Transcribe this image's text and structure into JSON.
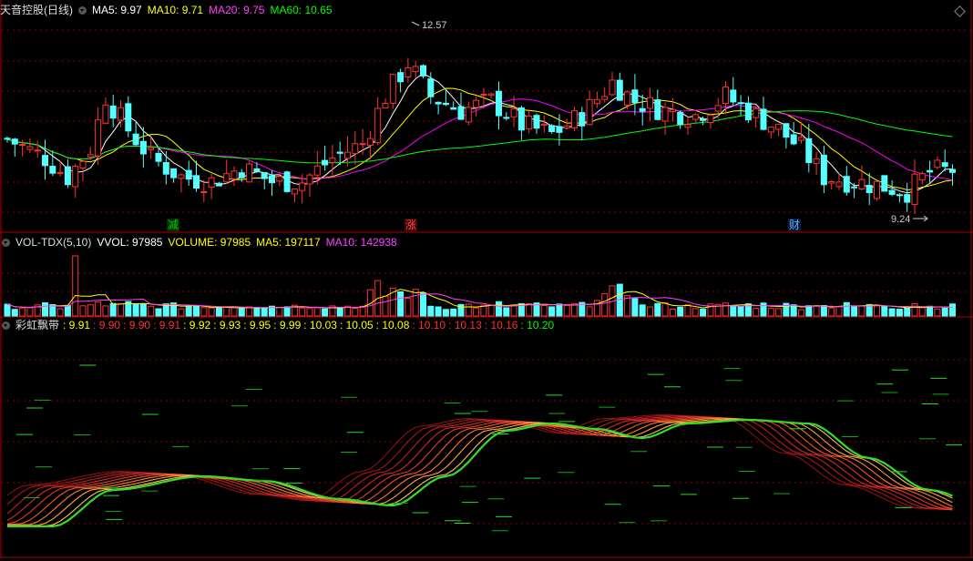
{
  "main": {
    "title": "天音控股(日线)",
    "ma5": "MA5: 9.97",
    "ma10": "MA10: 9.71",
    "ma20": "MA20: 9.75",
    "ma60": "MA60: 10.65",
    "high_label": "12.57",
    "low_label": "9.24",
    "mark_jian": "减",
    "mark_zhang": "涨",
    "mark_cai": "财"
  },
  "vol": {
    "title": "VOL-TDX(5,10)",
    "vvol": "VVOL: 97985",
    "volume": "VOLUME: 97985",
    "ma5": "MA5: 197117",
    "ma10": "MA10: 142938"
  },
  "rainbow": {
    "title": "彩虹飘带",
    "values": [
      ": 9.91",
      ": 9.90",
      ": 9.90",
      ": 9.91",
      ": 9.92",
      ": 9.93",
      ": 9.95",
      ": 9.99",
      ": 10.03",
      ": 10.05",
      ": 10.08",
      ": 10.10",
      ": 10.13",
      ": 10.16",
      ": 10.20"
    ],
    "colors": [
      "#ffff00",
      "#ff3030",
      "#ff3030",
      "#ff3030",
      "#ffff00",
      "#ffff00",
      "#ffff00",
      "#ffff00",
      "#ffff00",
      "#ffff00",
      "#ffff00",
      "#ff3030",
      "#ff3030",
      "#ff3030",
      "#00ff00"
    ]
  },
  "colors": {
    "up": "#ff3232",
    "down": "#54ffff",
    "ma5": "#ffffff",
    "ma10": "#ffff00",
    "ma20": "#ff00ff",
    "ma60": "#00ff00",
    "grid": "#8b0000",
    "border": "#b00000"
  },
  "chart_data": [
    {
      "type": "candlestick",
      "title": "天音控股(日线)",
      "series": [
        {
          "name": "MA5",
          "values": [
            9.8,
            9.9,
            10.1,
            10.4,
            10.8,
            11.0,
            10.9,
            10.6,
            10.4,
            10.6,
            11.2,
            11.4,
            11.3,
            11.0,
            10.6,
            10.2,
            9.7,
            9.5,
            9.3,
            9.6
          ]
        },
        {
          "name": "MA10",
          "values": [
            9.7,
            9.8,
            10.0,
            10.3,
            10.6,
            10.8,
            10.9,
            10.8,
            10.6,
            10.6,
            10.9,
            11.1,
            11.2,
            11.1,
            10.8,
            10.4,
            10.0,
            9.7,
            9.5,
            9.7
          ]
        },
        {
          "name": "MA20",
          "values": [
            9.8,
            9.8,
            9.9,
            10.1,
            10.3,
            10.5,
            10.7,
            10.8,
            10.7,
            10.6,
            10.7,
            10.9,
            11.0,
            11.1,
            10.9,
            10.7,
            10.3,
            10.0,
            9.8,
            9.75
          ]
        },
        {
          "name": "MA60",
          "values": [
            10.1,
            10.0,
            9.9,
            9.9,
            10.0,
            10.1,
            10.2,
            10.3,
            10.4,
            10.5,
            10.6,
            10.7,
            10.8,
            10.9,
            10.95,
            10.95,
            10.9,
            10.85,
            10.75,
            10.65
          ]
        }
      ],
      "annotations": [
        "12.57",
        "9.24",
        "减",
        "涨",
        "财"
      ]
    },
    {
      "type": "bar",
      "title": "VOL-TDX(5,10)",
      "series": [
        {
          "name": "VOLUME",
          "last": 97985
        },
        {
          "name": "MA5",
          "last": 197117
        },
        {
          "name": "MA10",
          "last": 142938
        }
      ]
    },
    {
      "type": "line",
      "title": "彩虹飘带",
      "series": [
        {
          "name": "band",
          "values": [
            9.91,
            9.9,
            9.9,
            9.91,
            9.92,
            9.93,
            9.95,
            9.99,
            10.03,
            10.05,
            10.08,
            10.1,
            10.13,
            10.16,
            10.2
          ]
        }
      ]
    }
  ]
}
